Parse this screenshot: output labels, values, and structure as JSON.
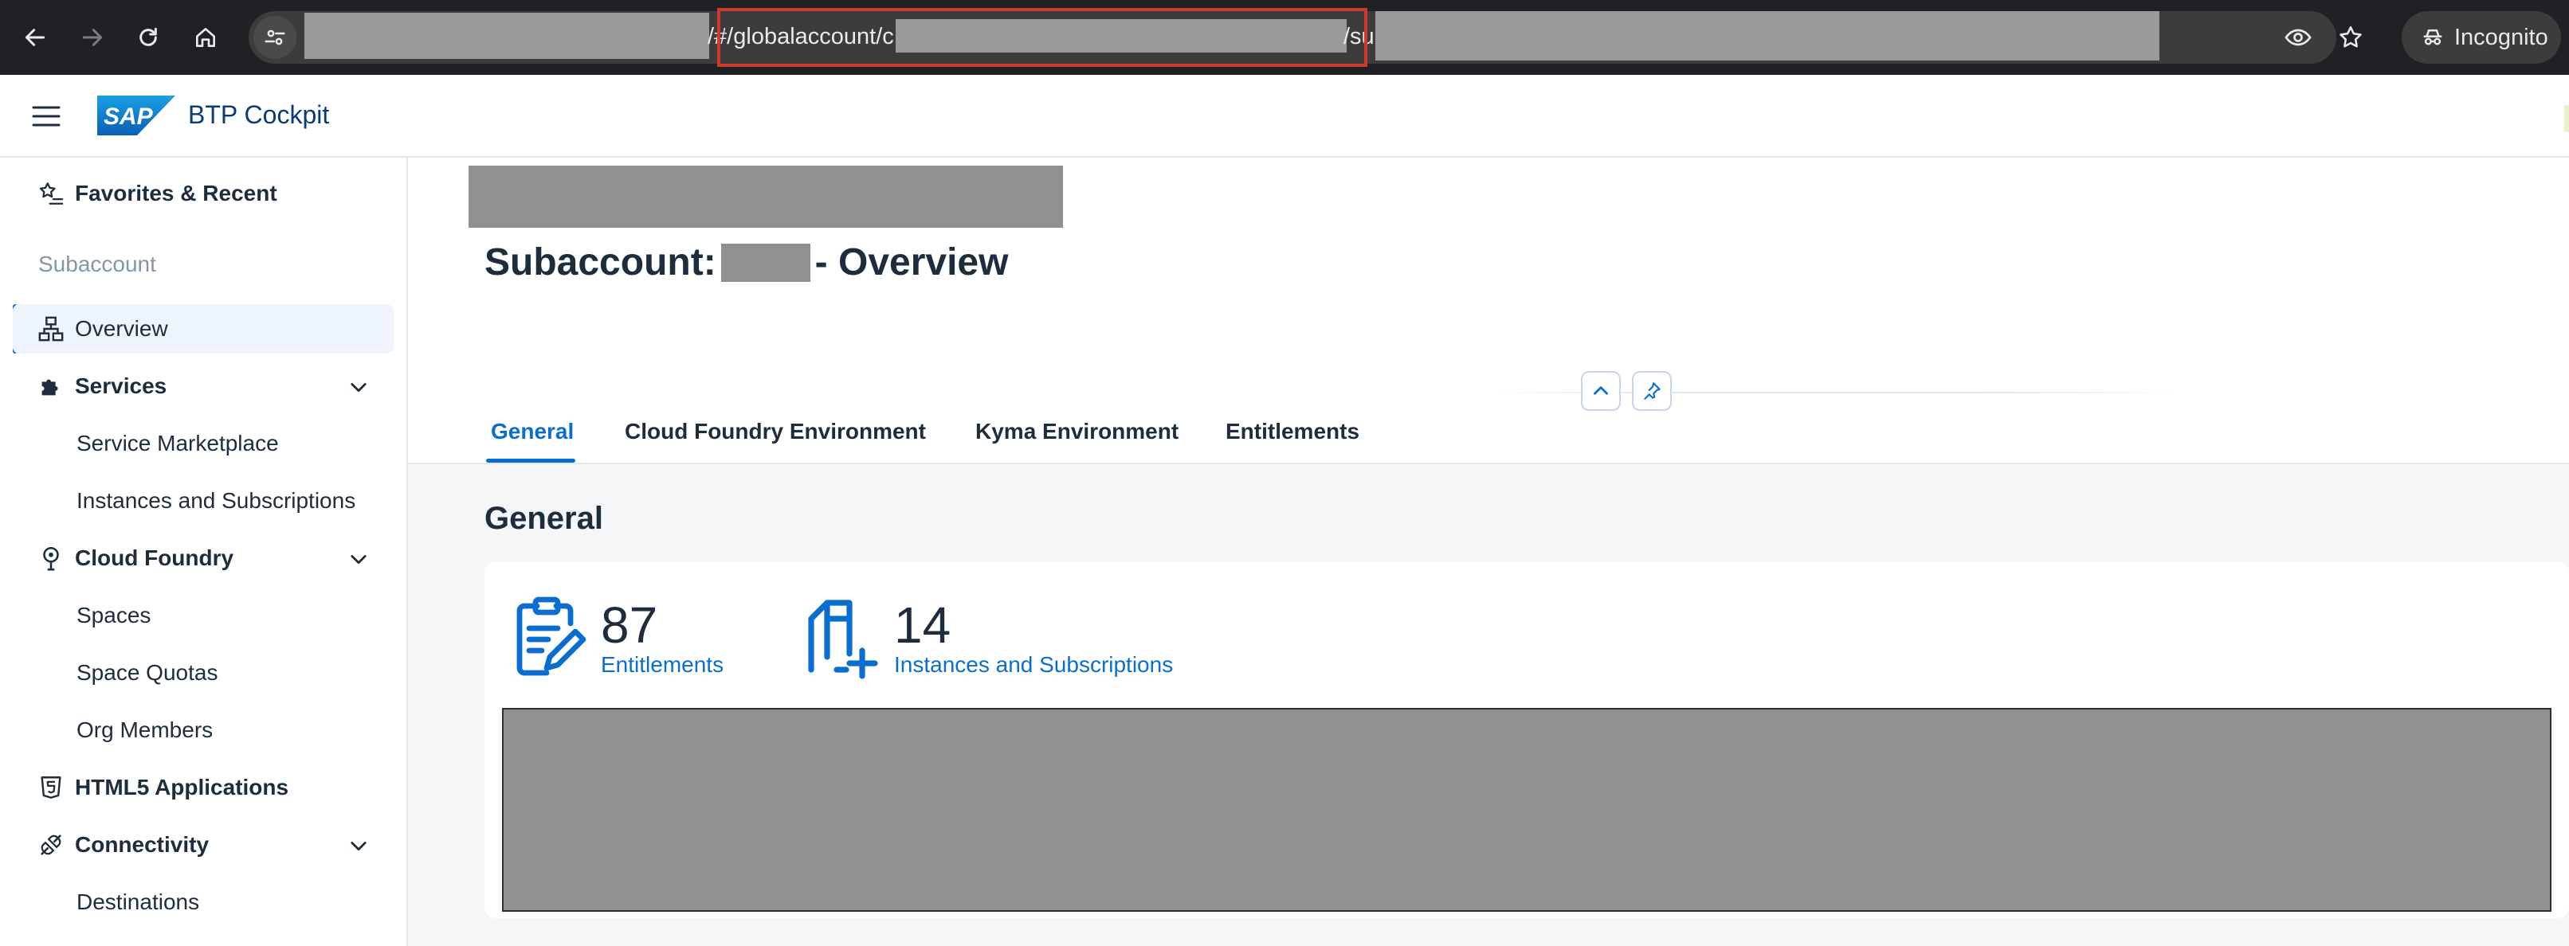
{
  "browser": {
    "url_visible_1": "/#/globalaccount/c",
    "url_visible_2": "/su",
    "incognito_label": "Incognito"
  },
  "shell": {
    "brand_logo_text": "SAP",
    "app_title": "BTP Cockpit"
  },
  "sidebar": {
    "favorites": "Favorites & Recent",
    "group_label": "Subaccount",
    "items": {
      "overview": "Overview",
      "services": "Services",
      "service_marketplace": "Service Marketplace",
      "instances_subscriptions": "Instances and Subscriptions",
      "cloud_foundry": "Cloud Foundry",
      "spaces": "Spaces",
      "space_quotas": "Space Quotas",
      "org_members": "Org Members",
      "html5_apps": "HTML5 Applications",
      "connectivity": "Connectivity",
      "destinations": "Destinations"
    }
  },
  "page": {
    "title_prefix": "Subaccount:",
    "title_suffix": "- Overview",
    "tabs": [
      "General",
      "Cloud Foundry Environment",
      "Kyma Environment",
      "Entitlements"
    ],
    "section_title": "General",
    "kpis": {
      "entitlements": {
        "value": "87",
        "label": "Entitlements"
      },
      "instances": {
        "value": "14",
        "label": "Instances and Subscriptions"
      }
    }
  },
  "colors": {
    "accent": "#0a6ed1",
    "url_highlight": "#d03a2a",
    "redaction": "#909090"
  }
}
